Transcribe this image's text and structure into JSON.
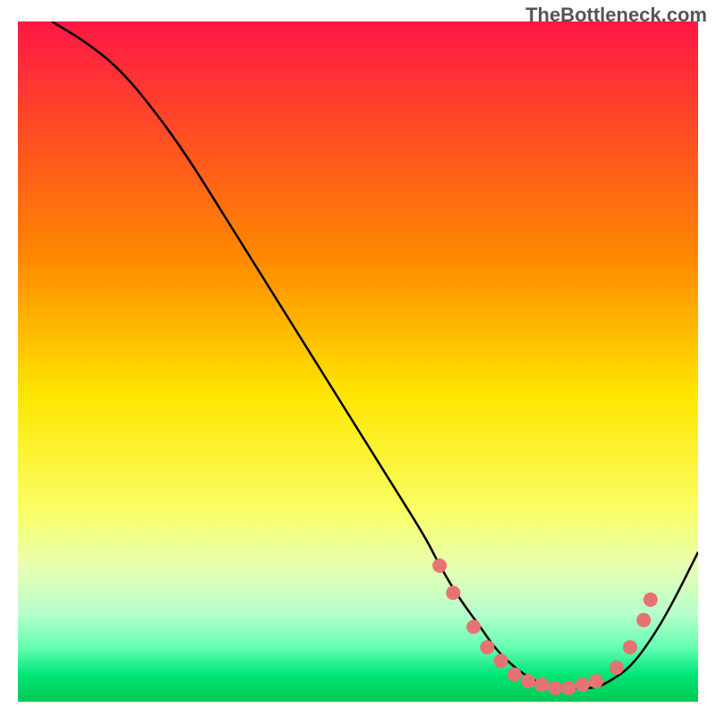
{
  "watermark": "TheBottleneck.com",
  "chart_data": {
    "type": "line",
    "title": "",
    "xlabel": "",
    "ylabel": "",
    "xlim": [
      0,
      100
    ],
    "ylim": [
      0,
      100
    ],
    "gradient_stops": [
      {
        "offset": 0,
        "color": "#ff1744"
      },
      {
        "offset": 35,
        "color": "#ff8a00"
      },
      {
        "offset": 55,
        "color": "#ffe600"
      },
      {
        "offset": 72,
        "color": "#f9ff66"
      },
      {
        "offset": 80,
        "color": "#e8ffb0"
      },
      {
        "offset": 87,
        "color": "#b8ffcc"
      },
      {
        "offset": 92,
        "color": "#66ffb3"
      },
      {
        "offset": 96,
        "color": "#00e676"
      },
      {
        "offset": 100,
        "color": "#00c853"
      }
    ],
    "series": [
      {
        "name": "bottleneck-curve",
        "color": "#000000",
        "x": [
          5,
          10,
          15,
          20,
          25,
          30,
          35,
          40,
          45,
          50,
          55,
          60,
          62,
          65,
          68,
          70,
          73,
          76,
          79,
          82,
          85,
          87,
          90,
          93,
          96,
          100
        ],
        "y": [
          100,
          97,
          93,
          87,
          80,
          72,
          64,
          56,
          48,
          40,
          32,
          24,
          20,
          15,
          11,
          8,
          5,
          3,
          2,
          2,
          2,
          3,
          5,
          9,
          14,
          22
        ]
      }
    ],
    "markers": {
      "name": "highlight-dots",
      "color": "#e57373",
      "radius": 8,
      "points": [
        {
          "x": 62,
          "y": 20
        },
        {
          "x": 64,
          "y": 16
        },
        {
          "x": 67,
          "y": 11
        },
        {
          "x": 69,
          "y": 8
        },
        {
          "x": 71,
          "y": 6
        },
        {
          "x": 73,
          "y": 4
        },
        {
          "x": 75,
          "y": 3
        },
        {
          "x": 77,
          "y": 2.5
        },
        {
          "x": 79,
          "y": 2
        },
        {
          "x": 81,
          "y": 2
        },
        {
          "x": 83,
          "y": 2.5
        },
        {
          "x": 85,
          "y": 3
        },
        {
          "x": 88,
          "y": 5
        },
        {
          "x": 90,
          "y": 8
        },
        {
          "x": 92,
          "y": 12
        },
        {
          "x": 93,
          "y": 15
        }
      ]
    }
  }
}
